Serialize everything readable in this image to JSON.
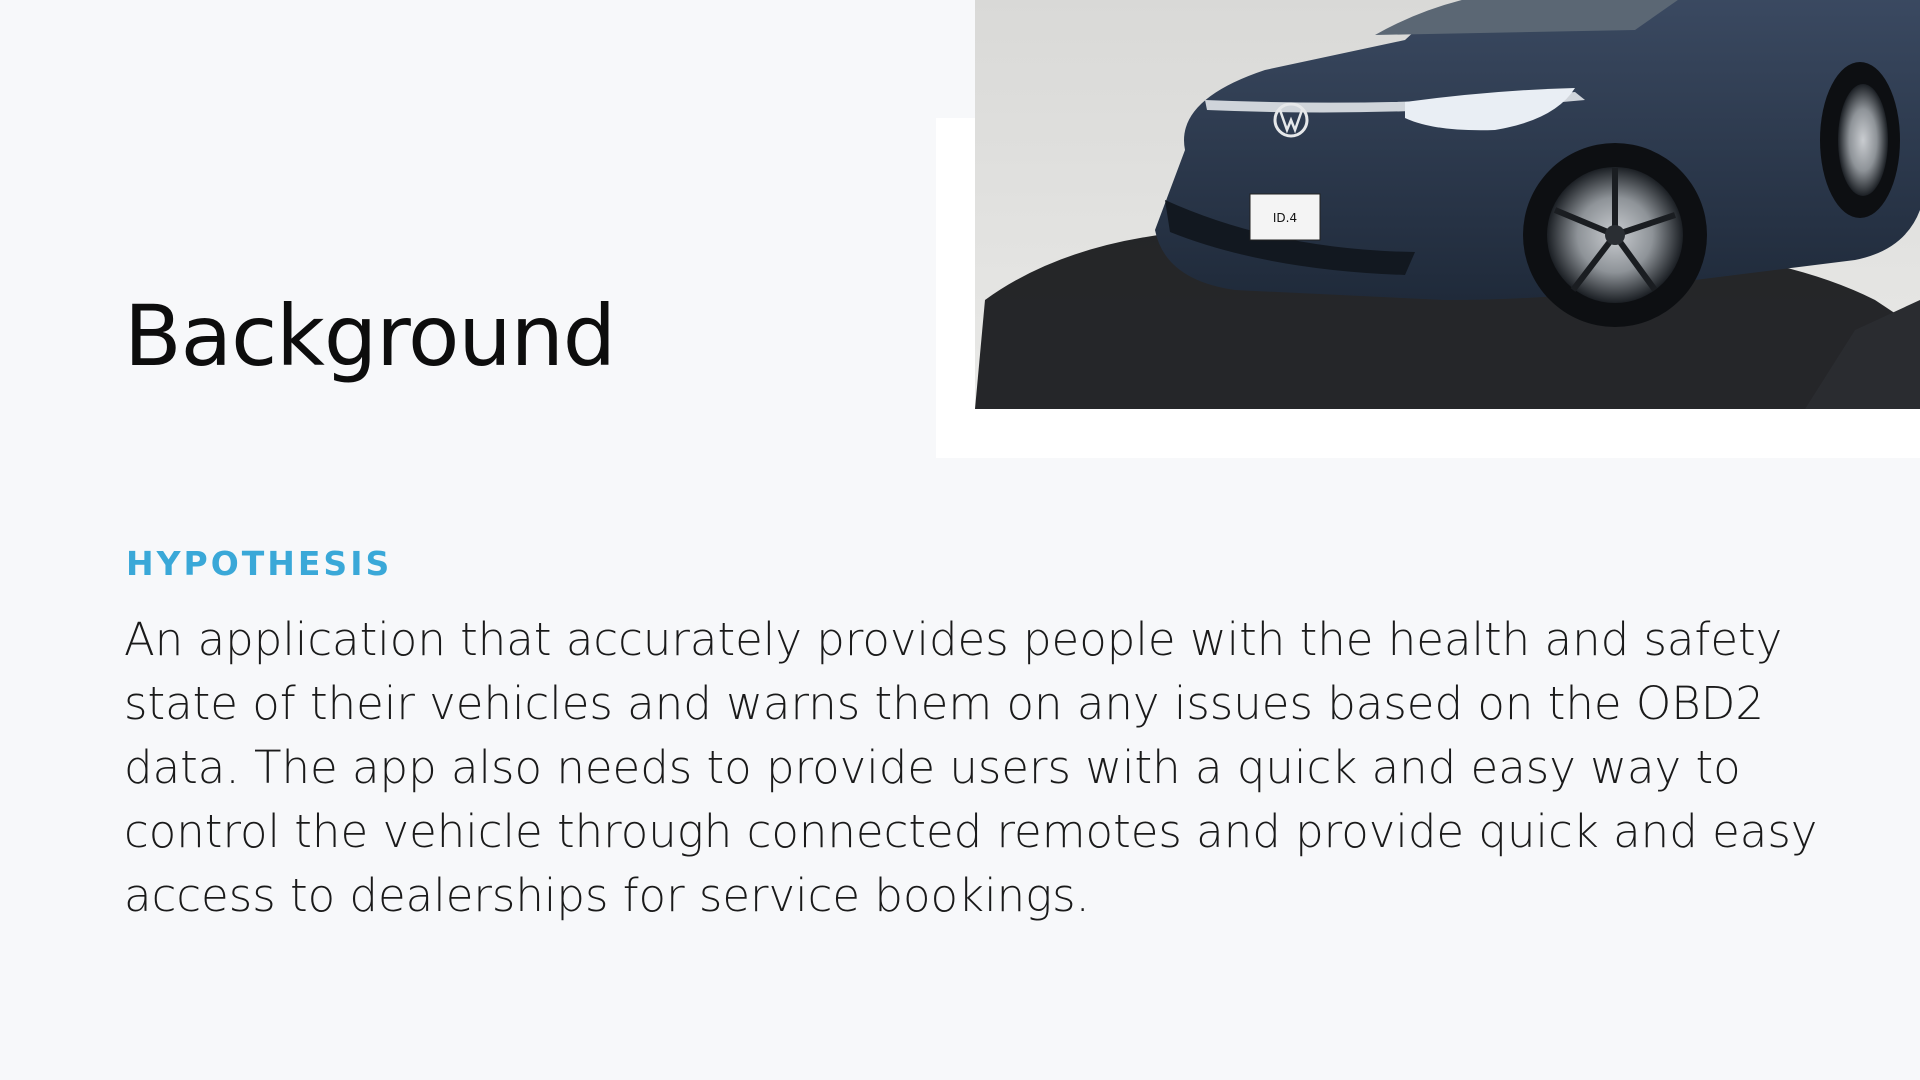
{
  "slide": {
    "title": "Background",
    "section_label": "HYPOTHESIS",
    "body": "An application that accurately provides people with the health and safety state of their vehicles and warns them on any issues based on the OBD2 data. The app also needs to provide users with a quick and easy way to control the vehicle through connected remotes and provide quick and easy access to dealerships for service bookings."
  },
  "image": {
    "description_icon": "vehicle-photo",
    "plate_text": "ID.4",
    "car_color": "#2c3a4e",
    "accent_color": "#3aa8d8"
  }
}
